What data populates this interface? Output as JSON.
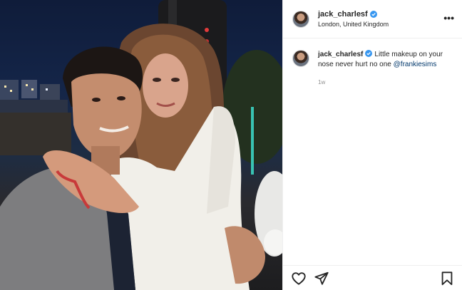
{
  "post": {
    "author": {
      "username": "jack_charlesf",
      "verified": true,
      "location": "London, United Kingdom"
    },
    "caption": {
      "username": "jack_charlesf",
      "text": "Little makeup on your nose never hurt no one ",
      "mention": "@frankiesims",
      "time": "1w"
    },
    "more_glyph": "•••"
  },
  "colors": {
    "verified_badge": "#3897f0",
    "mention": "#00376b",
    "muted_text": "#8e8e8e",
    "divider": "#efefef"
  },
  "icons": [
    "more-options-icon",
    "verified-badge-icon",
    "heart-icon",
    "share-icon",
    "bookmark-icon"
  ]
}
